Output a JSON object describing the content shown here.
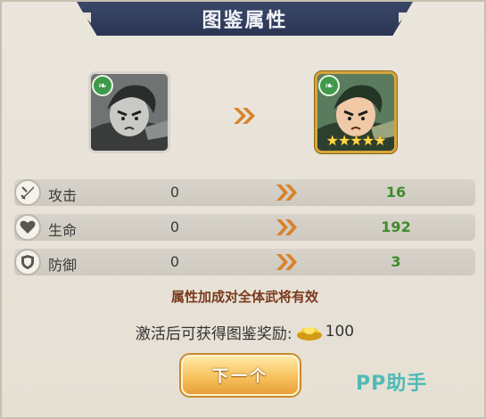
{
  "title": "图鉴属性",
  "hero_before": {
    "badge_icon": "green-leaf-icon"
  },
  "hero_after": {
    "badge_icon": "green-leaf-icon",
    "stars": "★★★★★",
    "star_count": 5
  },
  "stats": [
    {
      "label": "攻击",
      "icon": "sword-icon",
      "before": "0",
      "after": "16"
    },
    {
      "label": "生命",
      "icon": "heart-icon",
      "before": "0",
      "after": "192"
    },
    {
      "label": "防御",
      "icon": "shield-icon",
      "before": "0",
      "after": "3"
    }
  ],
  "note": "属性加成对全体武将有效",
  "reward": {
    "label": "激活后可获得图鉴奖励:",
    "icon": "gold-ingot-icon",
    "amount": "100"
  },
  "next_button": "下一个",
  "watermark": "PP助手",
  "colors": {
    "title_bg": "#2f3b5a",
    "accent_orange": "#d9822b",
    "value_green": "#3e8b2c",
    "button_gold": "#f6c15c"
  }
}
